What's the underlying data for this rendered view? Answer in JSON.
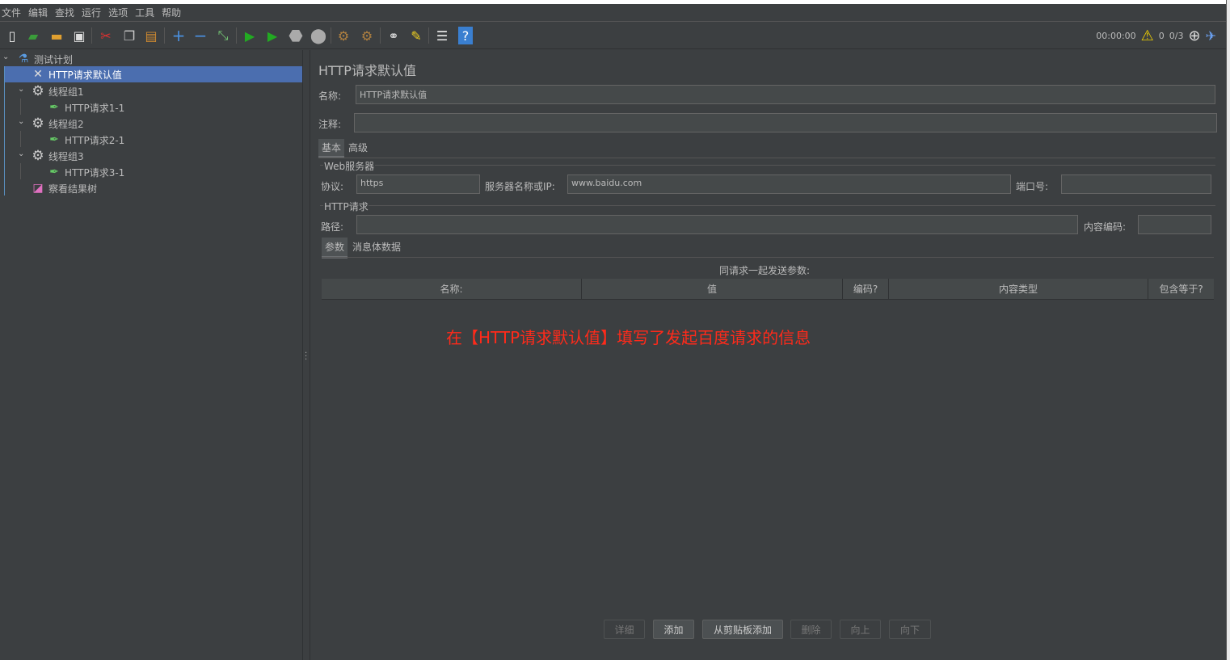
{
  "menu": [
    "文件",
    "编辑",
    "查找",
    "运行",
    "选项",
    "工具",
    "帮助"
  ],
  "toolbar": {
    "icons": [
      "new-icon",
      "templates-icon",
      "open-icon",
      "save-icon",
      "cut-icon",
      "copy-icon",
      "paste-icon",
      "expand-icon",
      "collapse-icon",
      "toggle-icon",
      "start-icon",
      "start-no-pause-icon",
      "stop-icon",
      "shutdown-icon",
      "clear-icon",
      "clear-all-icon",
      "search-icon",
      "reset-search-icon",
      "function-helper-icon",
      "help-icon"
    ]
  },
  "status": {
    "timer": "00:00:00",
    "warnings": "0",
    "threads": "0/3"
  },
  "tree": {
    "root": "测试计划",
    "items": [
      "HTTP请求默认值",
      "线程组1",
      "HTTP请求1-1",
      "线程组2",
      "HTTP请求2-1",
      "线程组3",
      "HTTP请求3-1",
      "察看结果树"
    ]
  },
  "panel": {
    "title": "HTTP请求默认值",
    "name_label": "名称:",
    "name_value": "HTTP请求默认值",
    "comment_label": "注释:",
    "comment_value": "",
    "tabs": [
      "基本",
      "高级"
    ],
    "web_server_legend": "Web服务器",
    "protocol_label": "协议:",
    "protocol_value": "https",
    "server_label": "服务器名称或IP:",
    "server_value": "www.baidu.com",
    "port_label": "端口号:",
    "port_value": "",
    "http_legend": "HTTP请求",
    "path_label": "路径:",
    "path_value": "",
    "encoding_label": "内容编码:",
    "encoding_value": "",
    "subtabs": [
      "参数",
      "消息体数据"
    ],
    "params_caption": "同请求一起发送参数:",
    "columns": [
      "名称:",
      "值",
      "编码?",
      "内容类型",
      "包含等于?"
    ],
    "buttons": [
      "详细",
      "添加",
      "从剪贴板添加",
      "删除",
      "向上",
      "向下"
    ]
  },
  "annotation": "在【HTTP请求默认值】填写了发起百度请求的信息"
}
